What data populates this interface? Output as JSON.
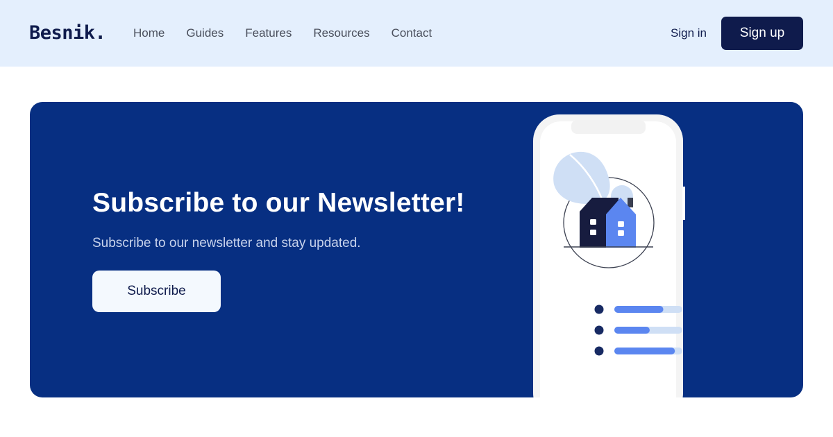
{
  "brand": {
    "logo": "Besnik."
  },
  "nav": {
    "links": [
      "Home",
      "Guides",
      "Features",
      "Resources",
      "Contact"
    ],
    "sign_in": "Sign in",
    "sign_up": "Sign up"
  },
  "hero": {
    "headline": "Subscribe to our Newsletter!",
    "subtext": "Subscribe to our newsletter and stay updated.",
    "subscribe_label": "Subscribe"
  },
  "illustration": {
    "list_progress": [
      0.72,
      0.52,
      0.89
    ]
  },
  "colors": {
    "nav_background": "#e4effd",
    "brand_dark": "#0f1b4c",
    "banner_background": "#072f82",
    "accent_blue": "#5b86f0",
    "light_blue": "#cfdff5"
  }
}
